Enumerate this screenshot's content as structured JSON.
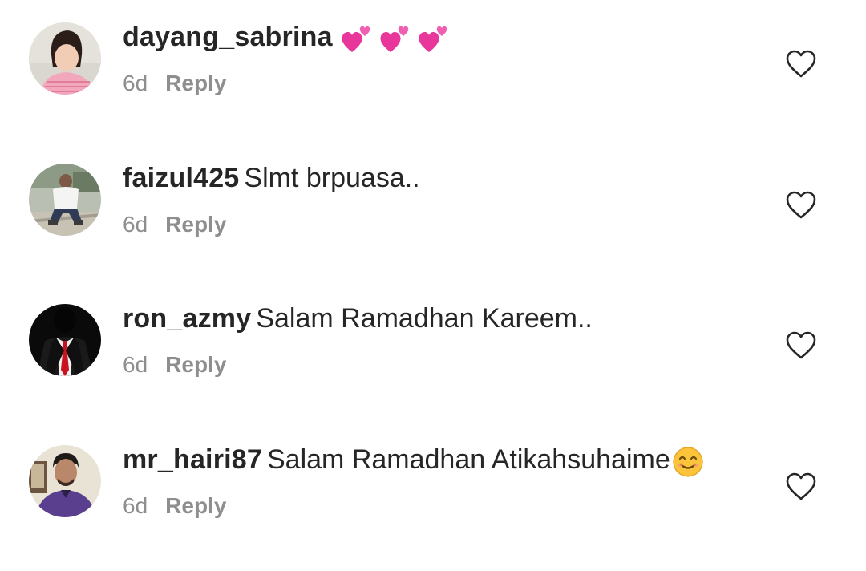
{
  "comments": [
    {
      "username": "dayang_sabrina",
      "text": "",
      "emoji": "two-hearts-emoji",
      "time": "6d",
      "reply_label": "Reply",
      "like_icon": "heart-outline-icon"
    },
    {
      "username": "faizul425",
      "text": "Slmt brpuasa..",
      "time": "6d",
      "reply_label": "Reply",
      "like_icon": "heart-outline-icon"
    },
    {
      "username": "ron_azmy",
      "text": "Salam Ramadhan Kareem..",
      "time": "6d",
      "reply_label": "Reply",
      "like_icon": "heart-outline-icon"
    },
    {
      "username": "mr_hairi87",
      "text": "Salam Ramadhan Atikahsuhaime",
      "emoji": "smiling-face-emoji",
      "time": "6d",
      "reply_label": "Reply",
      "like_icon": "heart-outline-icon"
    }
  ],
  "colors": {
    "text": "#262626",
    "secondary": "#8e8e8e",
    "heart_emoji": "#e8369a"
  }
}
